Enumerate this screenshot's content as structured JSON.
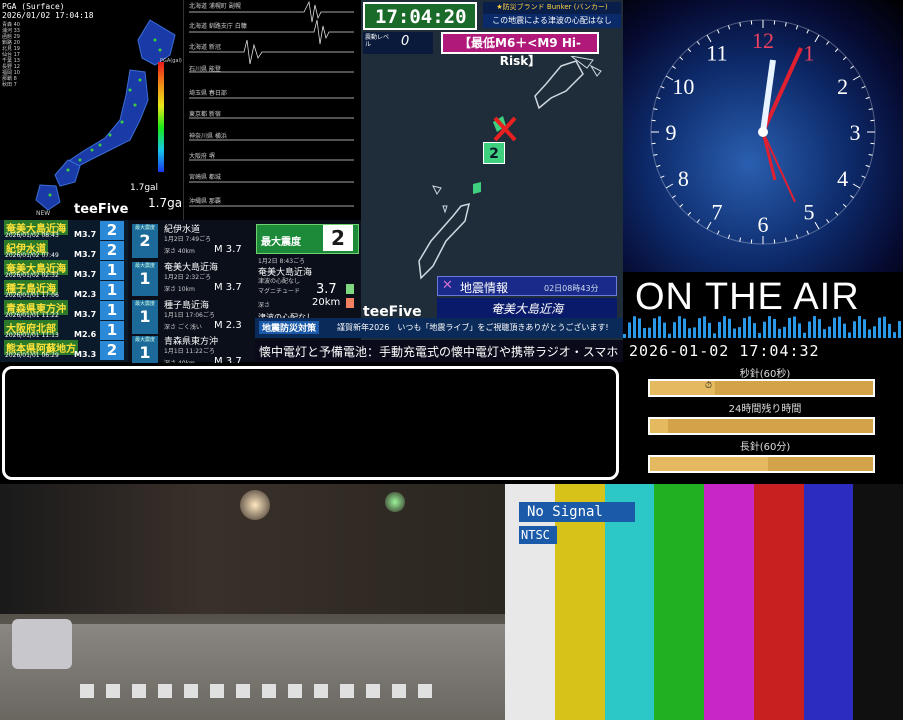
{
  "map": {
    "header1": "PGA (Surface)",
    "header2": "2026/01/02 17:04:18",
    "legend_title": "PGA(gal)",
    "scale_label": "1.7gal",
    "small_label": "1.7gal",
    "brand": "teeFive",
    "brand_small": "NEW"
  },
  "waves": [
    {
      "label": "北海道 浦幌町 副幌"
    },
    {
      "label": "北海道 釧路支庁 白糠"
    },
    {
      "label": "北海道 新冠"
    },
    {
      "label": "石川県 能登"
    },
    {
      "label": "埼玉県 春日部"
    },
    {
      "label": "東京都 新宿"
    },
    {
      "label": "神奈川県 横浜"
    },
    {
      "label": "大阪府 堺"
    },
    {
      "label": "宮崎県 都城"
    },
    {
      "label": "沖縄県 那覇"
    }
  ],
  "list": [
    {
      "name": "奄美大島近海",
      "date": "2026/01/02 08:43",
      "mag": "M3.7",
      "int": "2"
    },
    {
      "name": "紀伊水道",
      "date": "2026/01/02 07:49",
      "mag": "M3.7",
      "int": "2"
    },
    {
      "name": "奄美大島近海",
      "date": "2026/01/02 02:32",
      "mag": "M3.7",
      "int": "1"
    },
    {
      "name": "種子島近海",
      "date": "2026/01/01 17:06",
      "mag": "M2.3",
      "int": "1"
    },
    {
      "name": "青森県東方沖",
      "date": "2026/01/01 11:22",
      "mag": "M3.7",
      "int": "1"
    },
    {
      "name": "大阪府北部",
      "date": "2026/01/01 11:13",
      "mag": "M2.6",
      "int": "1"
    },
    {
      "name": "熊本県阿蘇地方",
      "date": "2026/01/01 06:29",
      "mag": "M3.3",
      "int": "2"
    }
  ],
  "details": [
    {
      "level": "最大震度",
      "int": "2",
      "place": "紀伊水道",
      "time": "1月2日 7:49ごろ",
      "depth": "深さ 40km",
      "mag": "M 3.7"
    },
    {
      "level": "最大震度",
      "int": "1",
      "place": "奄美大島近海",
      "time": "1月2日 2:32ごろ",
      "depth": "深さ 10km",
      "mag": "M 3.7"
    },
    {
      "level": "最大震度",
      "int": "1",
      "place": "種子島近海",
      "time": "1月1日 17:06ごろ",
      "depth": "深さ ごく浅い",
      "mag": "M 2.3"
    },
    {
      "level": "最大震度",
      "int": "1",
      "place": "青森県東方沖",
      "time": "1月1日 11:22ごろ",
      "depth": "深さ 40km",
      "mag": "M 3.7"
    }
  ],
  "latest": {
    "label": "最大震度",
    "int": "2",
    "time": "1月2日 8:43ごろ",
    "place": "奄美大島近海",
    "note": "津波の心配なし",
    "mag_label": "マグニチュード",
    "mag": "3.7",
    "depth_label": "深さ",
    "depth": "20km",
    "tsunami": "津波の心配なし"
  },
  "eew": {
    "time": "17:04:20",
    "brand_line": "★防災ブランド Bunker (バンカー)",
    "tsunami": "この地震による津波の心配はなし",
    "level_label": "震動レベル",
    "level_value": "0",
    "risk": "【最低M6＋<M9 Hi-Risk】",
    "epicenter_int": "2",
    "info_title": "地震情報",
    "info_time": "02日08時43分",
    "info_place": "奄美大島近海",
    "brand": "teeFive"
  },
  "ticker": {
    "tag": "地震防災対策",
    "text": "謹賀新年2026　いつも「地震ライブ」をご視聴頂きありがとうございます!",
    "scroll": "懐中電灯と予備電池：手動充電式の懐中電灯や携帯ラジオ・スマホ"
  },
  "clock": {
    "numerals": [
      "12",
      "1",
      "2",
      "3",
      "4",
      "5",
      "6",
      "7",
      "8",
      "9",
      "10",
      "11"
    ]
  },
  "onair": {
    "title": "ON THE AIR",
    "datetime": "2026-01-02 17:04:32",
    "bars": [
      {
        "label": "24時間残り時間",
        "fill": 0.29
      },
      {
        "label": "長針(60分)",
        "fill": 0.08
      },
      {
        "label": "秒針(60秒)",
        "fill": 0.53
      }
    ]
  },
  "bars_panel": {
    "no_signal": "No Signal",
    "ntsc": "NTSC",
    "colors": [
      "#e8e8e8",
      "#d7c21a",
      "#2cc8c8",
      "#21b021",
      "#c827c8",
      "#c82020",
      "#2c2cc0",
      "#101010"
    ]
  }
}
